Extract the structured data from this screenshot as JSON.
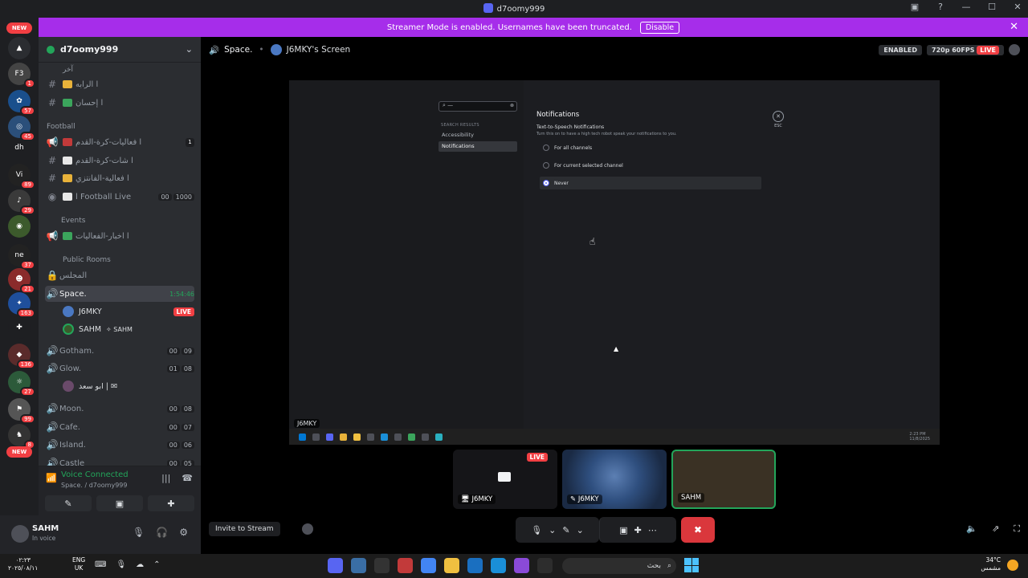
{
  "window": {
    "title": "d7oomy999",
    "buttons": [
      "▣",
      "?",
      "—",
      "☐",
      "✕"
    ]
  },
  "banner": {
    "text": "Streamer Mode is enabled. Usernames have been truncated.",
    "disable_label": "Disable",
    "close": "✕"
  },
  "rail": {
    "new_top": "NEW",
    "new_bottom": "NEW",
    "servers": [
      {
        "label": "▲",
        "badge": ""
      },
      {
        "label": "F3",
        "badge": "1"
      },
      {
        "label": "✿",
        "badge": "57"
      },
      {
        "label": "◎",
        "badge": "45"
      },
      {
        "label": "dh",
        "badge": ""
      },
      {
        "label": "Vi",
        "badge": "89"
      },
      {
        "label": "♪",
        "badge": "29"
      },
      {
        "label": "◉",
        "badge": ""
      },
      {
        "label": "ne",
        "badge": "37"
      },
      {
        "label": "☻",
        "badge": "21"
      },
      {
        "label": "✦",
        "badge": "163"
      },
      {
        "label": "✚",
        "badge": ""
      },
      {
        "label": "◆",
        "badge": "136"
      },
      {
        "label": "☼",
        "badge": "27"
      },
      {
        "label": "⚑",
        "badge": "99"
      },
      {
        "label": "♞",
        "badge": "8"
      }
    ]
  },
  "guild": {
    "name": "d7oomy999",
    "chevron": "⌄"
  },
  "channels": {
    "top_category": "آخر",
    "items": [
      {
        "sym": "#",
        "name": "ا الرابه",
        "emo": "#e8b23a"
      },
      {
        "sym": "#",
        "name": "ا إحسان",
        "emo": "#3ba55c"
      }
    ],
    "football_category": "Football",
    "football": [
      {
        "sym": "📢",
        "name": "ا فعاليات-كرة-القدم",
        "red": "1"
      },
      {
        "sym": "#",
        "name": "ا شات-كرة-القدم",
        "red": ""
      },
      {
        "sym": "#",
        "name": "ا فعالية-الفانتزي",
        "red": ""
      },
      {
        "sym": "◉",
        "name": "ا Football Live",
        "counts": [
          "00",
          "1000"
        ]
      }
    ],
    "events_category": "Events",
    "events": [
      {
        "sym": "📢",
        "name": "ا اخبار-الفعاليات"
      }
    ],
    "public_category": "Public Rooms",
    "public_first": "المجلس",
    "space": {
      "name": "Space.",
      "timer": "1:54:46"
    },
    "space_members": [
      {
        "name": "J6MKY",
        "tag": "LIVE"
      },
      {
        "name": "SAHM",
        "tag": "✧ SAHM"
      }
    ],
    "rooms": [
      {
        "name": "Gotham.",
        "counts": [
          "00",
          "09"
        ]
      },
      {
        "name": "Glow.",
        "counts": [
          "01",
          "08"
        ]
      }
    ],
    "glow_member": "ابو سعد | ✉",
    "rooms2": [
      {
        "name": "Moon.",
        "counts": [
          "00",
          "08"
        ]
      },
      {
        "name": "Cafe.",
        "counts": [
          "00",
          "07"
        ]
      },
      {
        "name": "Island.",
        "counts": [
          "00",
          "06"
        ]
      },
      {
        "name": "Castle",
        "counts": [
          "00",
          "05"
        ]
      }
    ]
  },
  "voice": {
    "status": "Voice Connected",
    "location": "Space. / d7oomy999"
  },
  "user": {
    "name": "SAHM",
    "status": "In voice"
  },
  "stage": {
    "channel": "Space.",
    "screen_title": "J6MKY's Screen",
    "enabled_label": "ENABLED",
    "quality_label": "720p 60FPS",
    "live_label": "LIVE"
  },
  "shared_screen": {
    "search_value": "—",
    "search_results_label": "SEARCH RESULTS",
    "left_items": [
      "Accessibility",
      "Notifications"
    ],
    "section_title": "Notifications",
    "sub_title": "Text-to-Speech Notifications",
    "description": "Turn this on to have a high tech robot speak your notifications to you.",
    "options": [
      "For all channels",
      "For current selected channel",
      "Never"
    ],
    "esc_label": "ESC",
    "taskbar_name": "J6MKY",
    "tray_time": "2:23 PM",
    "tray_date": "11/8/2025"
  },
  "tiles": [
    {
      "name": "J6MKY",
      "live": "LIVE"
    },
    {
      "name": "J6MKY"
    },
    {
      "name": "SAHM"
    }
  ],
  "controls": {
    "invite_label": "Invite to Stream"
  },
  "taskbar": {
    "time": "٠٢:٢٣",
    "date": "٢٠٢٥/٠٨/١١",
    "lang_top": "ENG",
    "lang_bottom": "UK",
    "search_text": "بحث",
    "weather_temp": "34°C",
    "weather_desc": "مشمس"
  }
}
